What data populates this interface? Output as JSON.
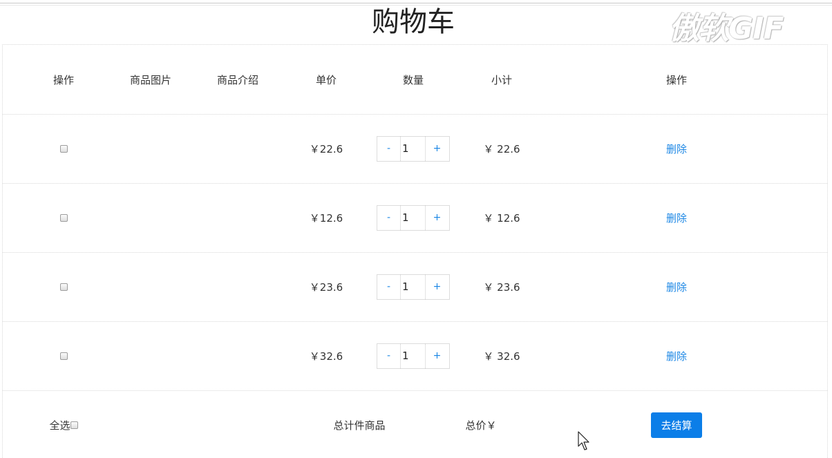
{
  "page": {
    "title": "购物车",
    "watermark": "傲软GIF"
  },
  "table": {
    "headers": [
      "操作",
      "商品图片",
      "商品介绍",
      "单价",
      "数量",
      "小计",
      "操作"
    ],
    "rows": [
      {
        "price": "￥22.6",
        "quantity": "1",
        "subtotal": "￥ 22.6",
        "delete_label": "删除"
      },
      {
        "price": "￥12.6",
        "quantity": "1",
        "subtotal": "￥ 12.6",
        "delete_label": "删除"
      },
      {
        "price": "￥23.6",
        "quantity": "1",
        "subtotal": "￥ 23.6",
        "delete_label": "删除"
      },
      {
        "price": "￥32.6",
        "quantity": "1",
        "subtotal": "￥ 32.6",
        "delete_label": "删除"
      }
    ],
    "stepper": {
      "minus_label": "-",
      "plus_label": "+"
    }
  },
  "footer": {
    "select_all_label": "全选",
    "total_items_label": "总计件商品",
    "total_price_label": "总价￥",
    "checkout_label": "去结算"
  },
  "colors": {
    "accent": "#1e88e5",
    "checkout_bg": "#0b7ee8"
  }
}
